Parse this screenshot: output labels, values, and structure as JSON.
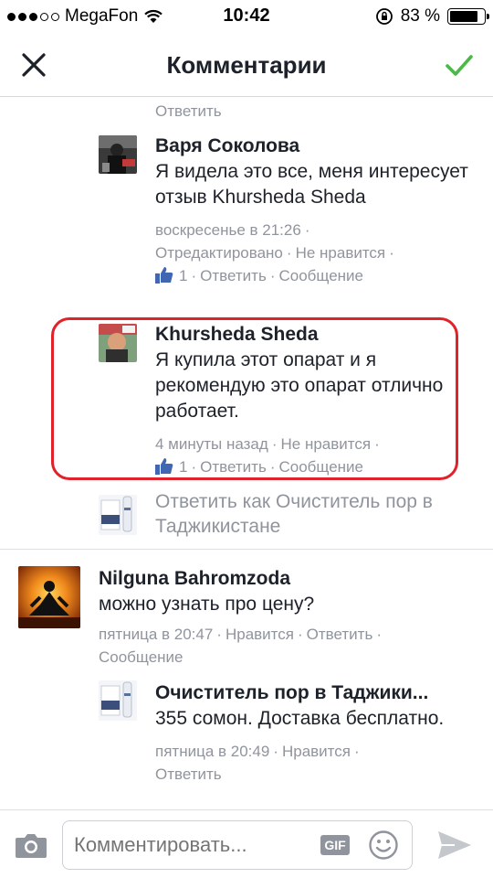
{
  "status": {
    "carrier": "MegaFon",
    "time": "10:42",
    "battery": "83 %",
    "battery_level": 0.83
  },
  "nav": {
    "title": "Комментарии"
  },
  "feed": {
    "prev_reply": "Ответить",
    "comment1": {
      "name": "Варя Соколова",
      "text": "Я видела это все, меня интересует отзыв  Khursheda Sheda",
      "time": "воскресенье в 21:26",
      "edited": "Отредактировано",
      "unlike": "Не нравится",
      "likes": "1",
      "reply": "Ответить",
      "message": "Сообщение"
    },
    "comment2": {
      "name": "Khursheda Sheda",
      "text": "Я купила этот опарат и я рекомендую это опарат отлично работает.",
      "time": "4 минуты назад",
      "unlike": "Не нравится",
      "likes": "1",
      "reply": "Ответить",
      "message": "Сообщение"
    },
    "reply_as": "Ответить как Очиститель пор в Таджикистане",
    "comment3": {
      "name": "Nilguna Bahromzoda",
      "text": "можно узнать про цену?",
      "time": "пятница в 20:47",
      "like": "Нравится",
      "reply": "Ответить",
      "message": "Сообщение"
    },
    "comment4": {
      "name": "Очиститель пор в Таджики...",
      "text": "355 сомон. Доставка бесплатно.",
      "time": "пятница в 20:49",
      "like": "Нравится",
      "reply": "Ответить"
    }
  },
  "composer": {
    "placeholder": "Комментировать...",
    "gif": "GIF"
  },
  "colors": {
    "accent_green": "#4cb848",
    "highlight_red": "#e0222a",
    "meta_gray": "#90949c",
    "like_blue": "#4267b2"
  }
}
